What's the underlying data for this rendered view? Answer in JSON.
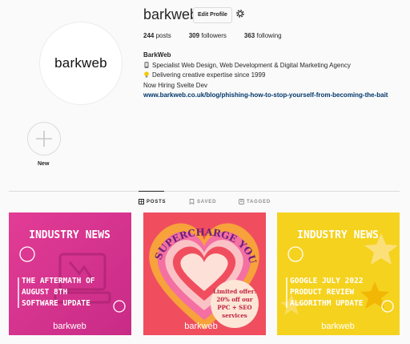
{
  "profile": {
    "username": "barkweb",
    "edit_label": "Edit Profile",
    "avatar_wordmark": "barkweb",
    "stats": {
      "posts_count": "244",
      "posts_label": "posts",
      "followers_count": "309",
      "followers_label": "followers",
      "following_count": "363",
      "following_label": "following"
    },
    "bio": {
      "name": "BarkWeb",
      "line1": "Specialist Web Design, Web Development & Digital Marketing Agency",
      "line2": "Delivering creative expertise since 1999",
      "line3": "Now Hiring Svelte Dev",
      "link": "www.barkweb.co.uk/blog/phishing-how-to-stop-yourself-from-becoming-the-bait"
    }
  },
  "highlight": {
    "new_label": "New"
  },
  "tabs": [
    {
      "label": "POSTS",
      "active": true
    },
    {
      "label": "SAVED",
      "active": false
    },
    {
      "label": "TAGGED",
      "active": false
    }
  ],
  "posts": [
    {
      "heading": "INDUSTRY NEWS",
      "lines": [
        "THE AFTERMATH OF",
        "AUGUST 8TH",
        "SOFTWARE UPDATE"
      ],
      "brand": "barkweb",
      "bg": "#e0439a"
    },
    {
      "curved_text": "SUPERCHARGE YOUR ORGANIC SEARCH",
      "offer_lines": [
        "Limited offer:",
        "20% off our",
        "PPC + SEO",
        "services"
      ],
      "brand": "barkweb",
      "bg": "#f04e5e"
    },
    {
      "heading": "INDUSTRY NEWS",
      "lines": [
        "GOOGLE JULY 2022",
        "PRODUCT REVIEW",
        "ALGORITHM UPDATE"
      ],
      "brand": "barkweb",
      "bg": "#f5d21e"
    }
  ],
  "colors": {
    "link": "#00376b",
    "border": "#dbdbdb",
    "muted": "#8e8e8e"
  }
}
